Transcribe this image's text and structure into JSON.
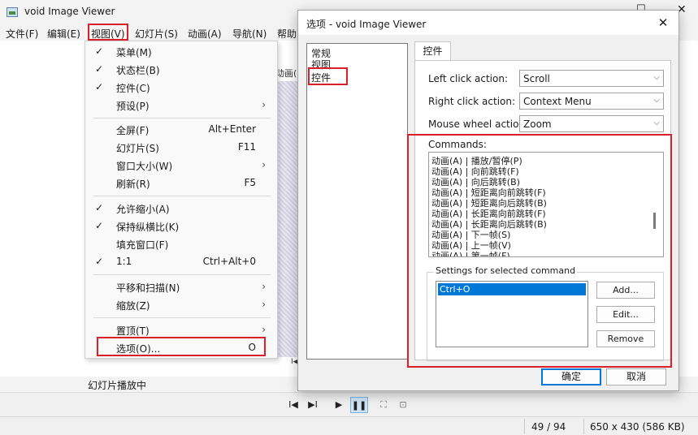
{
  "window": {
    "title": "void Image Viewer",
    "controls": {
      "minimize": "—",
      "maximize": "☐",
      "close": "✕"
    }
  },
  "menubar": {
    "items": [
      "文件(F)",
      "编辑(E)",
      "视图(V)",
      "幻灯片(S)",
      "动画(A)",
      "导航(N)",
      "帮助("
    ],
    "active": "视图(V)"
  },
  "view_menu": {
    "items": [
      {
        "label": "菜单(M)",
        "checked": true,
        "shortcut": "",
        "submenu": false
      },
      {
        "label": "状态栏(B)",
        "checked": true,
        "shortcut": "",
        "submenu": false
      },
      {
        "label": "控件(C)",
        "checked": true,
        "shortcut": "",
        "submenu": false
      },
      {
        "label": "预设(P)",
        "checked": false,
        "shortcut": "",
        "submenu": true
      },
      {
        "label": "全屏(F)",
        "checked": false,
        "shortcut": "Alt+Enter",
        "submenu": false
      },
      {
        "label": "幻灯片(S)",
        "checked": false,
        "shortcut": "F11",
        "submenu": false
      },
      {
        "label": "窗口大小(W)",
        "checked": false,
        "shortcut": "",
        "submenu": true
      },
      {
        "label": "刷新(R)",
        "checked": false,
        "shortcut": "F5",
        "submenu": false
      },
      {
        "label": "允许缩小(A)",
        "checked": true,
        "shortcut": "",
        "submenu": false
      },
      {
        "label": "保持纵横比(K)",
        "checked": true,
        "shortcut": "",
        "submenu": false
      },
      {
        "label": "填充窗口(F)",
        "checked": false,
        "shortcut": "",
        "submenu": false
      },
      {
        "label": "1:1",
        "checked": true,
        "shortcut": "Ctrl+Alt+0",
        "submenu": false
      },
      {
        "label": "平移和扫描(N)",
        "checked": false,
        "shortcut": "",
        "submenu": true
      },
      {
        "label": "缩放(Z)",
        "checked": false,
        "shortcut": "",
        "submenu": true
      },
      {
        "label": "置顶(T)",
        "checked": false,
        "shortcut": "",
        "submenu": true
      },
      {
        "label": "选项(O)...",
        "checked": false,
        "shortcut": "O",
        "submenu": false
      }
    ]
  },
  "background": {
    "anim_label_fragment": "动画(",
    "nav_glyph": "I◀",
    "slideshow_status": "幻灯片播放中"
  },
  "toolbar": {
    "buttons": [
      "I◀",
      "▶I",
      "▶",
      "❚❚",
      "⛶",
      "⊡"
    ]
  },
  "statusbar": {
    "position": "49 / 94",
    "image_info": "650 x 430 (586 KB)"
  },
  "dialog": {
    "title": "选项 - void Image Viewer",
    "close_glyph": "✕",
    "tree": [
      "常规",
      "视图",
      "控件"
    ],
    "selected_tree_item": "控件",
    "tab": "控件",
    "left_click_label": "Left click action:",
    "left_click_value": "Scroll",
    "right_click_label": "Right click action:",
    "right_click_value": "Context Menu",
    "wheel_label": "Mouse wheel action:",
    "wheel_value": "Zoom",
    "commands_label": "Commands:",
    "commands": [
      "动画(A) | 播放/暂停(P)",
      "动画(A) | 向前跳转(F)",
      "动画(A) | 向后跳转(B)",
      "动画(A) | 短距离向前跳转(F)",
      "动画(A) | 短距离向后跳转(B)",
      "动画(A) | 长距离向前跳转(F)",
      "动画(A) | 长距离向后跳转(B)",
      "动画(A) | 下一帧(S)",
      "动画(A) | 上一帧(V)",
      "动画(A) | 第一帧(F)"
    ],
    "settings_label": "Settings for selected command",
    "shortcuts": [
      "Ctrl+O"
    ],
    "add_label": "Add...",
    "edit_label": "Edit...",
    "remove_label": "Remove",
    "ok_label": "确定",
    "cancel_label": "取消"
  },
  "colors": {
    "highlight_box": "#d9202a",
    "selection": "#0078d7",
    "pause_active": "#cce4f7"
  }
}
